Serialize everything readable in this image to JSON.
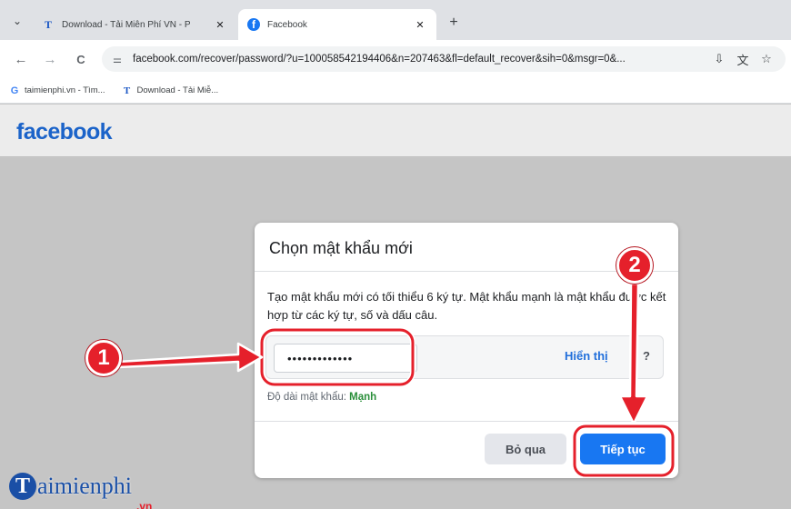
{
  "browser": {
    "tabs": [
      {
        "title": "Download - Tải Miễn Phí VN - P",
        "favicon": "taimienphi-icon",
        "active": false,
        "close": "✕"
      },
      {
        "title": "Facebook",
        "favicon": "facebook-icon",
        "active": true,
        "close": "✕"
      }
    ],
    "tab_menu": "⌄",
    "new_tab": "+",
    "nav": {
      "back": "←",
      "forward": "→",
      "reload": "C"
    },
    "site_info_icon": "⚌",
    "url": "facebook.com/recover/password/?u=100058542194406&n=207463&fl=default_recover&sih=0&msgr=0&...",
    "url_icons": {
      "install": "⇩",
      "translate": "文",
      "star": "☆"
    },
    "bookmarks": [
      {
        "label": "taimienphi.vn - Tìm...",
        "icon": "G"
      },
      {
        "label": "Download - Tải Miễ...",
        "icon": "T"
      }
    ]
  },
  "page": {
    "logo": "facebook",
    "dialog": {
      "title": "Chọn mật khẩu mới",
      "description": "Tạo mật khẩu mới có tối thiểu 6 ký tự. Mật khẩu mạnh là mật khẩu được kết hợp từ các ký tự, số và dấu câu.",
      "password_value": "•••••••••••••",
      "show_label": "Hiển thị",
      "help_label": "?",
      "strength_label": "Độ dài mật khẩu:",
      "strength_value": "Mạnh",
      "skip_label": "Bỏ qua",
      "continue_label": "Tiếp tục"
    }
  },
  "annotations": {
    "step1": "1",
    "step2": "2",
    "highlight_color": "#e5202b"
  },
  "watermark": {
    "letter": "T",
    "text": "aimienphi",
    "suffix": ".vn"
  },
  "colors": {
    "facebook_blue": "#1877f2",
    "strength_green": "#2a8f3a"
  }
}
